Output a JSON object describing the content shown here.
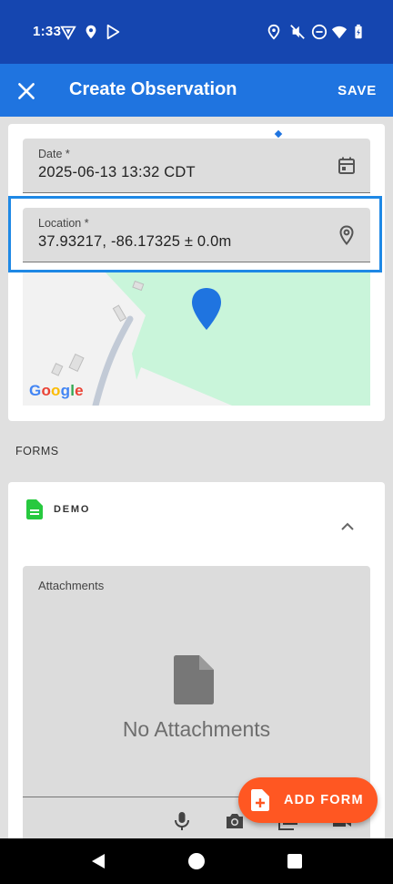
{
  "status_bar": {
    "time": "1:33",
    "icons": [
      "vpn-icon",
      "location-icon",
      "play-icon",
      "location-icon",
      "mute-icon",
      "dnd-icon",
      "wifi-icon",
      "battery-icon"
    ]
  },
  "app_bar": {
    "title": "Create Observation",
    "save_label": "SAVE",
    "close_icon": "close-icon"
  },
  "observation": {
    "date_label": "Date *",
    "date_value": "2025-06-13 13:32 CDT",
    "location_label": "Location *",
    "location_value": "37.93217, -86.17325 ± 0.0m"
  },
  "map": {
    "attribution": "Google",
    "marker_color": "#1f74e0"
  },
  "forms": {
    "heading": "FORMS",
    "items": [
      {
        "name": "DEMO",
        "icon": "document-icon",
        "icon_color": "#27c93f",
        "attachments": {
          "label": "Attachments",
          "empty_text": "No Attachments",
          "actions": [
            "microphone-icon",
            "camera-icon",
            "gallery-icon",
            "video-icon"
          ]
        }
      }
    ]
  },
  "fab": {
    "label": "ADD FORM",
    "color": "#ff5722"
  },
  "colors": {
    "status_bar": "#1546b0",
    "app_bar": "#1f74e0",
    "highlight": "#1e88e5"
  }
}
